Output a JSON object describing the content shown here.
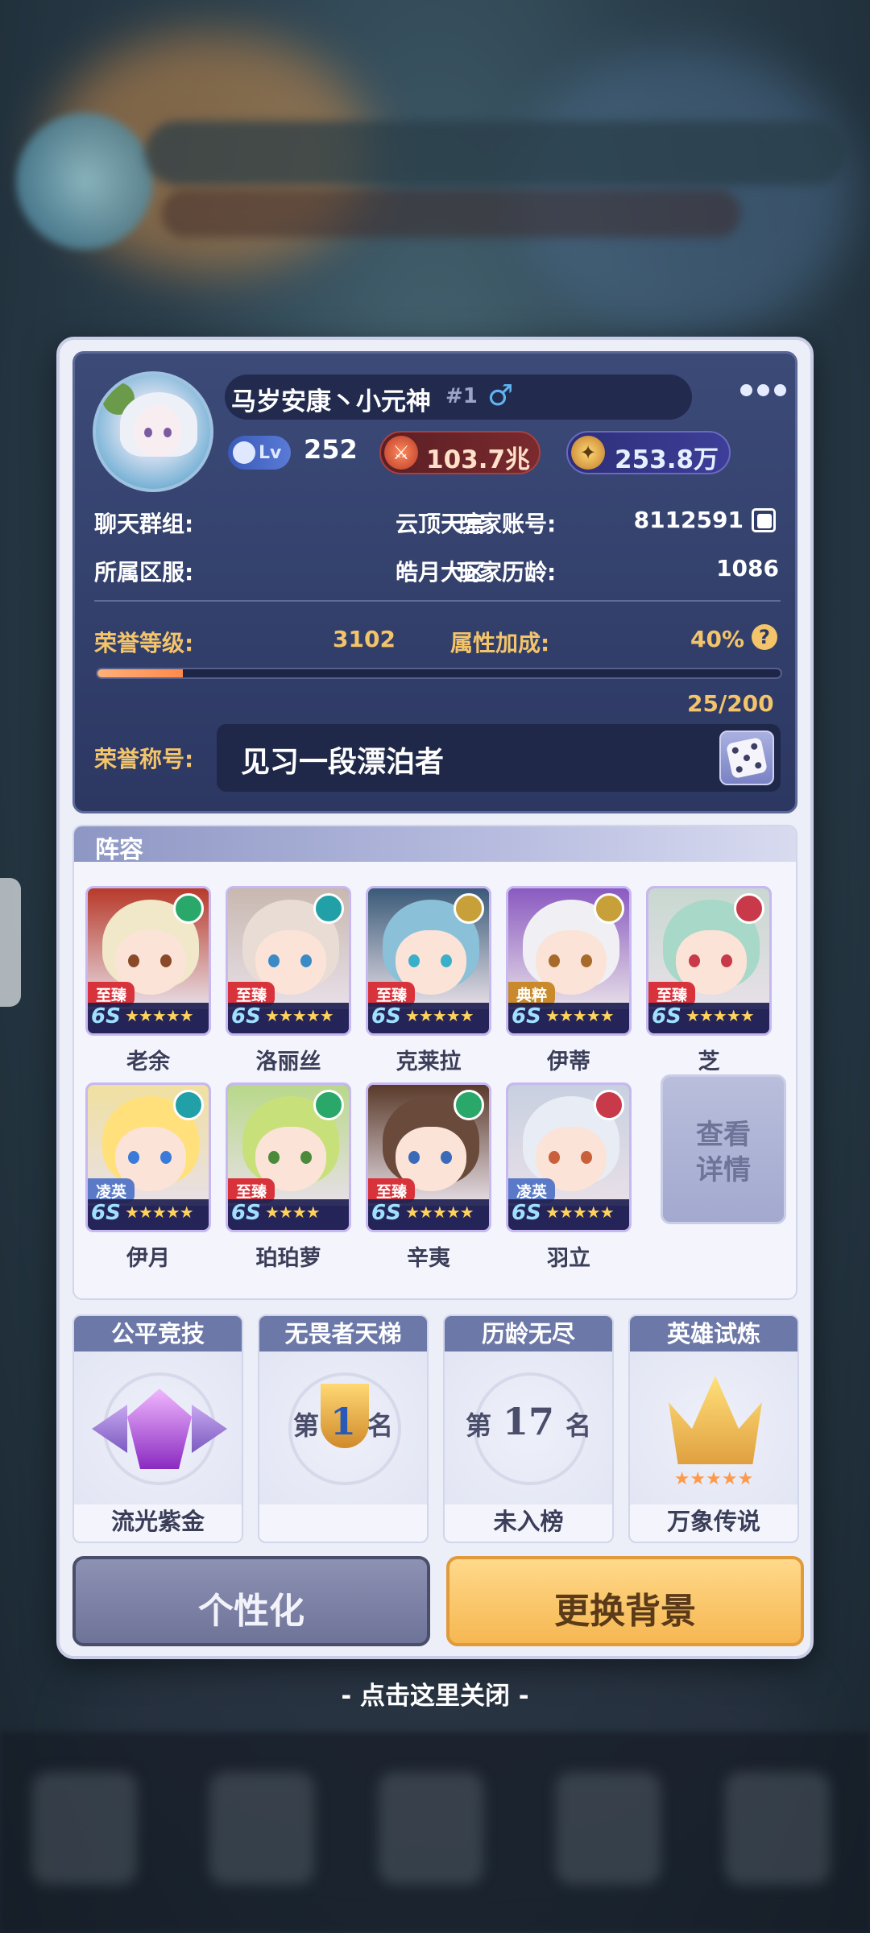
{
  "profile": {
    "name": "马岁安康丶小元神",
    "rank_tag": "#1",
    "gender_symbol": "♂",
    "level_label": "Lv",
    "level": "252",
    "currency_gold": "103.7兆",
    "currency_star": "253.8万"
  },
  "info": {
    "chat_group_label": "聊天群组:",
    "chat_group_value": "云顶天宫",
    "account_label": "玩家账号:",
    "account_value": "8112591",
    "server_label": "所属区服:",
    "server_value": "皓月大区",
    "age_label": "玩家历龄:",
    "age_value": "1086"
  },
  "honor": {
    "level_label": "荣誉等级:",
    "level_value": "3102",
    "bonus_label": "属性加成:",
    "bonus_value": "40%",
    "progress_text": "25/200",
    "progress": 0.125,
    "title_label": "荣誉称号:",
    "title_value": "见习一段漂泊者"
  },
  "lineup": {
    "header": "阵容",
    "view_detail": "查看\n详情",
    "heroes": [
      {
        "name": "老余",
        "tag": "至臻",
        "grade": "6S",
        "stars": "★★★★★",
        "tag_color": "#d8323a",
        "elem_color": "#2aa86a",
        "art": "#b83a2a",
        "hair": "#f0e8c8",
        "eye": "#8a4a2a"
      },
      {
        "name": "洛丽丝",
        "tag": "至臻",
        "grade": "6S",
        "stars": "★★★★★",
        "tag_color": "#d8323a",
        "elem_color": "#22a0a8",
        "art": "#c8b8b0",
        "hair": "#e8dcd4",
        "eye": "#3a8ac8"
      },
      {
        "name": "克莱拉",
        "tag": "至臻",
        "grade": "6S",
        "stars": "★★★★★",
        "tag_color": "#d8323a",
        "elem_color": "#c8a03a",
        "art": "#3a5a78",
        "hair": "#8ac0d8",
        "eye": "#3ab0c8"
      },
      {
        "name": "伊蒂",
        "tag": "典粹",
        "grade": "6S",
        "stars": "★★★★★",
        "tag_color": "#c88a2a",
        "elem_color": "#c8a03a",
        "art": "#8a5ac0",
        "hair": "#f0f0f4",
        "eye": "#a86a2a"
      },
      {
        "name": "芝",
        "tag": "至臻",
        "grade": "6S",
        "stars": "★★★★★",
        "tag_color": "#d8323a",
        "elem_color": "#c83a4a",
        "art": "#c8d8d0",
        "hair": "#a8d8c8",
        "eye": "#c83a4a"
      },
      {
        "name": "伊月",
        "tag": "凌英",
        "grade": "6S",
        "stars": "★★★★★",
        "tag_color": "#5a7ac8",
        "elem_color": "#22a0a8",
        "art": "#f0e0a0",
        "hair": "#ffe07a",
        "eye": "#3a7ad8"
      },
      {
        "name": "珀珀萝",
        "tag": "至臻",
        "grade": "6S",
        "stars": "★★★★",
        "tag_color": "#d8323a",
        "elem_color": "#2aa86a",
        "art": "#b8d88a",
        "hair": "#c8e07a",
        "eye": "#4a8a3a"
      },
      {
        "name": "辛夷",
        "tag": "至臻",
        "grade": "6S",
        "stars": "★★★★★",
        "tag_color": "#d8323a",
        "elem_color": "#2aa86a",
        "art": "#5a3a2a",
        "hair": "#6a4a3a",
        "eye": "#3a6ab8"
      },
      {
        "name": "羽立",
        "tag": "凌英",
        "grade": "6S",
        "stars": "★★★★★",
        "tag_color": "#5a7ac8",
        "elem_color": "#c83a4a",
        "art": "#c8d0e0",
        "hair": "#e8ecf4",
        "eye": "#c8603a"
      }
    ]
  },
  "ranks": [
    {
      "title": "公平竞技",
      "footer": "流光紫金"
    },
    {
      "title": "无畏者天梯",
      "footer": "",
      "prefix": "第",
      "number": "1",
      "suffix": "名"
    },
    {
      "title": "历龄无尽",
      "footer": "未入榜",
      "prefix": "第",
      "number": "17",
      "suffix": "名"
    },
    {
      "title": "英雄试炼",
      "footer": "万象传说",
      "stars": "★★★★★"
    }
  ],
  "actions": {
    "personalize": "个性化",
    "change_background": "更换背景"
  },
  "close_hint": "- 点击这里关闭 -"
}
